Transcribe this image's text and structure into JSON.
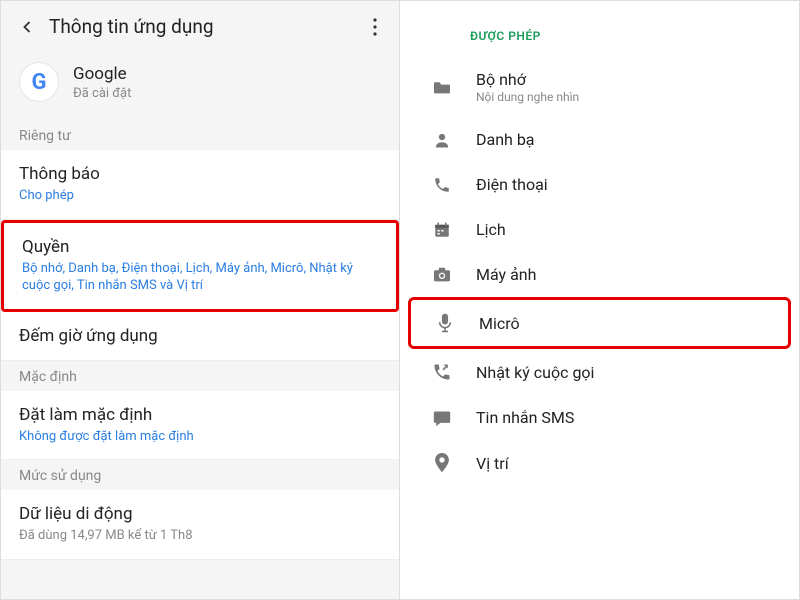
{
  "left": {
    "header": {
      "title": "Thông tin ứng dụng"
    },
    "app": {
      "name": "Google",
      "status": "Đã cài đặt"
    },
    "sections": {
      "privacy": "Riêng tư",
      "default": "Mặc định",
      "usage": "Mức sử dụng"
    },
    "items": {
      "notification": {
        "title": "Thông báo",
        "sub": "Cho phép"
      },
      "permissions": {
        "title": "Quyền",
        "sub": "Bộ nhớ, Danh bạ, Điện thoại, Lịch, Máy ảnh, Micrô, Nhật ký cuộc gọi, Tin nhắn SMS và Vị trí"
      },
      "timer": {
        "title": "Đếm giờ ứng dụng"
      },
      "setdefault": {
        "title": "Đặt làm mặc định",
        "sub": "Không được đặt làm mặc định"
      },
      "data": {
        "title": "Dữ liệu di động",
        "sub": "Đã dùng 14,97 MB kể từ 1 Th8"
      }
    }
  },
  "right": {
    "header": "ĐƯỢC PHÉP",
    "perms": {
      "storage": {
        "label": "Bộ nhớ",
        "sub": "Nội dung nghe nhìn"
      },
      "contacts": {
        "label": "Danh bạ"
      },
      "phone": {
        "label": "Điện thoại"
      },
      "calendar": {
        "label": "Lịch"
      },
      "camera": {
        "label": "Máy ảnh"
      },
      "microphone": {
        "label": "Micrô"
      },
      "calllog": {
        "label": "Nhật ký cuộc gọi"
      },
      "sms": {
        "label": "Tin nhắn SMS"
      },
      "location": {
        "label": "Vị trí"
      }
    }
  }
}
